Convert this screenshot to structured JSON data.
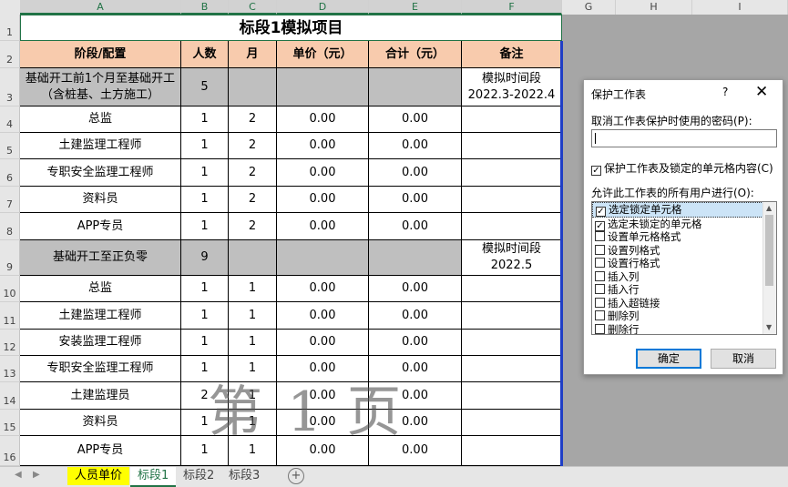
{
  "columns": [
    "A",
    "B",
    "C",
    "D",
    "E",
    "F",
    "G",
    "H",
    "I"
  ],
  "rows": [
    "1",
    "2",
    "3",
    "4",
    "5",
    "6",
    "7",
    "8",
    "9",
    "10",
    "11",
    "12",
    "13",
    "14",
    "15",
    "16"
  ],
  "title": "标段1模拟项目",
  "headers": [
    "阶段/配置",
    "人数",
    "月",
    "单价（元）",
    "合计（元）",
    "备注"
  ],
  "groups": [
    {
      "label": "基础开工前1个月至基础开工\n（含桩基、土方施工）",
      "count": "5",
      "note": "模拟时间段\n2022.3-2022.4"
    },
    {
      "label": "基础开工至正负零",
      "count": "9",
      "note": "模拟时间段\n2022.5"
    }
  ],
  "rows_group1": [
    {
      "role": "总监",
      "count": "1",
      "months": "2",
      "price": "0.00",
      "total": "0.00"
    },
    {
      "role": "土建监理工程师",
      "count": "1",
      "months": "2",
      "price": "0.00",
      "total": "0.00"
    },
    {
      "role": "专职安全监理工程师",
      "count": "1",
      "months": "2",
      "price": "0.00",
      "total": "0.00"
    },
    {
      "role": "资料员",
      "count": "1",
      "months": "2",
      "price": "0.00",
      "total": "0.00"
    },
    {
      "role": "APP专员",
      "count": "1",
      "months": "2",
      "price": "0.00",
      "total": "0.00"
    }
  ],
  "rows_group2": [
    {
      "role": "总监",
      "count": "1",
      "months": "1",
      "price": "0.00",
      "total": "0.00"
    },
    {
      "role": "土建监理工程师",
      "count": "1",
      "months": "1",
      "price": "0.00",
      "total": "0.00"
    },
    {
      "role": "安装监理工程师",
      "count": "1",
      "months": "1",
      "price": "0.00",
      "total": "0.00"
    },
    {
      "role": "专职安全监理工程师",
      "count": "1",
      "months": "1",
      "price": "0.00",
      "total": "0.00"
    },
    {
      "role": "土建监理员",
      "count": "2",
      "months": "1",
      "price": "0.00",
      "total": "0.00"
    },
    {
      "role": "资料员",
      "count": "1",
      "months": "1",
      "price": "0.00",
      "total": "0.00"
    },
    {
      "role": "APP专员",
      "count": "1",
      "months": "1",
      "price": "0.00",
      "total": "0.00"
    }
  ],
  "watermark": "第 1 页",
  "sheet_tabs": [
    "人员单价",
    "标段1",
    "标段2",
    "标段3"
  ],
  "active_tab": "标段1",
  "dialog": {
    "title": "保护工作表",
    "help": "?",
    "close": "✕",
    "password_label": "取消工作表保护时使用的密码(P):",
    "password_value": "",
    "protect_label": "保护工作表及锁定的单元格内容(C)",
    "protect_checked": true,
    "allow_label": "允许此工作表的所有用户进行(O):",
    "permissions": [
      {
        "label": "选定锁定单元格",
        "checked": true
      },
      {
        "label": "选定未锁定的单元格",
        "checked": true
      },
      {
        "label": "设置单元格格式",
        "checked": false
      },
      {
        "label": "设置列格式",
        "checked": false
      },
      {
        "label": "设置行格式",
        "checked": false
      },
      {
        "label": "插入列",
        "checked": false
      },
      {
        "label": "插入行",
        "checked": false
      },
      {
        "label": "插入超链接",
        "checked": false
      },
      {
        "label": "删除列",
        "checked": false
      },
      {
        "label": "删除行",
        "checked": false
      }
    ],
    "ok": "确定",
    "cancel": "取消"
  },
  "colors": {
    "header_fill": "#f8cbad",
    "group_fill": "#bfbfbf",
    "accent": "#217346",
    "tab_highlight": "#ffff00"
  }
}
